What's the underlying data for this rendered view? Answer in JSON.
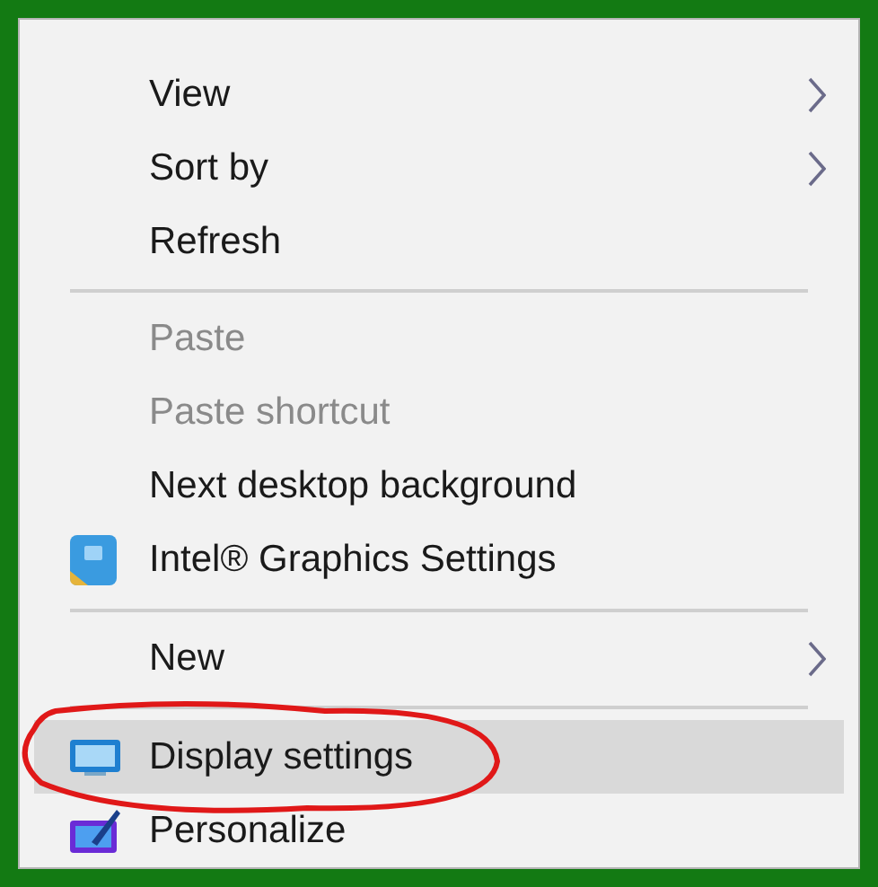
{
  "menu": {
    "items": [
      {
        "kind": "plain",
        "label": "View",
        "submenu": true,
        "disabled": false,
        "selected": false,
        "circled": false
      },
      {
        "kind": "plain",
        "label": "Sort by",
        "submenu": true,
        "disabled": false,
        "selected": false,
        "circled": false
      },
      {
        "kind": "plain",
        "label": "Refresh",
        "submenu": false,
        "disabled": false,
        "selected": false,
        "circled": false
      },
      {
        "kind": "separator"
      },
      {
        "kind": "plain",
        "label": "Paste",
        "submenu": false,
        "disabled": true,
        "selected": false,
        "circled": false
      },
      {
        "kind": "plain",
        "label": "Paste shortcut",
        "submenu": false,
        "disabled": true,
        "selected": false,
        "circled": false
      },
      {
        "kind": "plain",
        "label": "Next desktop background",
        "submenu": false,
        "disabled": false,
        "selected": false,
        "circled": false
      },
      {
        "kind": "graphics",
        "label": "Intel® Graphics Settings",
        "submenu": false,
        "disabled": false,
        "selected": false,
        "circled": false
      },
      {
        "kind": "separator"
      },
      {
        "kind": "plain",
        "label": "New",
        "submenu": true,
        "disabled": false,
        "selected": false,
        "circled": false
      },
      {
        "kind": "separator"
      },
      {
        "kind": "display",
        "label": "Display settings",
        "submenu": false,
        "disabled": false,
        "selected": true,
        "circled": true
      },
      {
        "kind": "personalize",
        "label": "Personalize",
        "submenu": false,
        "disabled": false,
        "selected": false,
        "circled": false
      }
    ]
  }
}
